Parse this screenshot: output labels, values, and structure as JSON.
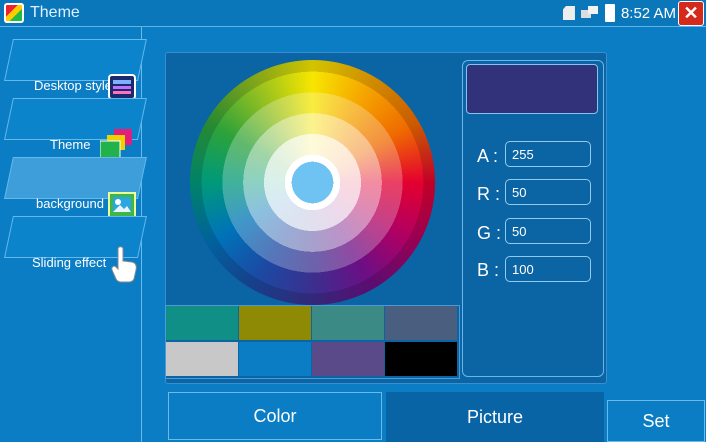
{
  "window": {
    "title": "Theme"
  },
  "status": {
    "time": "8:52 AM"
  },
  "sidebar": {
    "items": [
      {
        "label": "Desktop style",
        "icon": "keyboard-icon"
      },
      {
        "label": "Theme",
        "icon": "theme-icon"
      },
      {
        "label": "background",
        "icon": "picture-icon"
      },
      {
        "label": "Sliding effect",
        "icon": "hand-touch-icon"
      }
    ]
  },
  "color": {
    "preview_hex": "#32327a",
    "fields": [
      {
        "label": "A :",
        "value": "255"
      },
      {
        "label": "R :",
        "value": "50"
      },
      {
        "label": "G :",
        "value": "50"
      },
      {
        "label": "B :",
        "value": "100"
      }
    ],
    "swatches": [
      "#0f8f86",
      "#8f8a06",
      "#3b8a86",
      "#4a5f80",
      "#c8c8c8",
      "#0a7dc4",
      "#5a4a8a",
      "#000000"
    ]
  },
  "tabs": {
    "color": "Color",
    "picture": "Picture"
  },
  "actions": {
    "set": "Set"
  }
}
